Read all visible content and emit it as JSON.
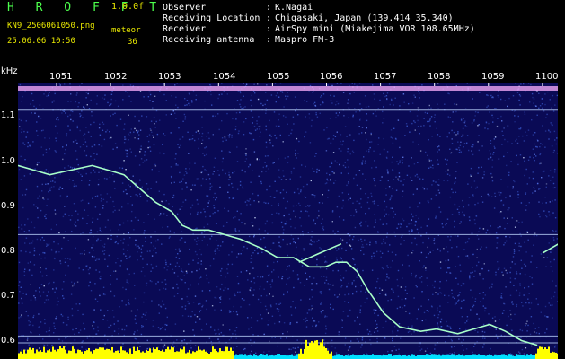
{
  "header": {
    "logo": "H R O F F T",
    "version": "1.0.0f",
    "filename": "KN9_2506061050.png",
    "datetime": "25.06.06 10:50",
    "mode": "meteor",
    "count": "36",
    "info": [
      {
        "label": "Observer",
        "value": "K.Nagai"
      },
      {
        "label": "Receiving Location",
        "value": "Chigasaki, Japan (139.414 35.340)"
      },
      {
        "label": "Receiver",
        "value": "AirSpy mini (Miakejima VOR 108.65MHz)"
      },
      {
        "label": "Receiving antenna",
        "value": "Maspro FM-3"
      }
    ]
  },
  "colors": {
    "background": "#0a0a55",
    "noise": "#3b5bd0",
    "trace": "#a8ffc8",
    "header_logo": "#4cff4c",
    "header_yellow": "#e8e800",
    "strip_yellow": "#ffff00",
    "strip_cyan": "#00e0ff"
  },
  "chart_data": {
    "type": "heatmap",
    "title": "",
    "xlabel": "",
    "ylabel": "kHz",
    "x_ticks": [
      "1051",
      "1052",
      "1053",
      "1054",
      "1055",
      "1056",
      "1057",
      "1058",
      "1059",
      "1100"
    ],
    "y_ticks": [
      "1.1",
      "1.0",
      "0.9",
      "0.8",
      "0.7",
      "0.6"
    ],
    "ylim": [
      0.57,
      1.17
    ],
    "horizontal_lines_khz": [
      1.11,
      0.84,
      0.62,
      0.605
    ],
    "traces": [
      {
        "x": [
          1050.0,
          1050.3,
          1050.6,
          1051.0,
          1051.4,
          1051.7,
          1052.0,
          1052.3,
          1052.6,
          1052.9,
          1053.1,
          1053.3,
          1053.6,
          1053.9,
          1054.2,
          1054.6,
          1054.9,
          1055.2,
          1055.5,
          1055.8,
          1056.0,
          1056.2,
          1056.4,
          1056.6,
          1056.9,
          1057.2,
          1057.6,
          1057.9,
          1058.3,
          1058.6,
          1058.9,
          1059.2,
          1059.5,
          1059.8
        ],
        "y": [
          0.99,
          0.98,
          0.97,
          0.98,
          0.99,
          0.98,
          0.97,
          0.94,
          0.91,
          0.89,
          0.86,
          0.85,
          0.85,
          0.84,
          0.83,
          0.81,
          0.79,
          0.79,
          0.77,
          0.77,
          0.78,
          0.78,
          0.76,
          0.72,
          0.67,
          0.64,
          0.63,
          0.635,
          0.625,
          0.635,
          0.645,
          0.63,
          0.61,
          0.6
        ]
      },
      {
        "x": [
          1055.3,
          1055.5,
          1055.7,
          1055.9,
          1056.1
        ],
        "y": [
          0.78,
          0.79,
          0.8,
          0.81,
          0.82
        ]
      },
      {
        "x": [
          1059.9,
          1060.2
        ],
        "y": [
          0.8,
          0.82
        ]
      }
    ]
  }
}
